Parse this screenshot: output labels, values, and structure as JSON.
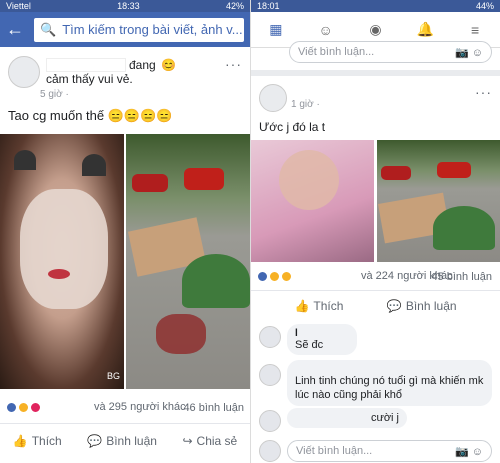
{
  "left": {
    "status": {
      "carrier": "Viettel",
      "time": "18:33",
      "battery": "42%"
    },
    "search": {
      "placeholder": "Tìm kiếm trong bài viết, ảnh v..."
    },
    "post": {
      "status_text": "đang",
      "feeling": "cảm thấy vui vẻ.",
      "meta": "5 giờ ·",
      "caption": "Tao cg muốn thế 😑😑😑😑",
      "photo_watermark": "BG",
      "reaction_count": "và 295 người khác",
      "comment_count": "46 bình luận",
      "actions": {
        "like": "Thích",
        "comment": "Bình luận",
        "share": "Chia sẻ"
      }
    }
  },
  "right": {
    "status": {
      "time": "18:01",
      "battery": "44%"
    },
    "prev_comment_placeholder": "Viết bình luận...",
    "post": {
      "meta": "1 giờ ·",
      "caption": "Ước j đó la t",
      "reaction_count": "và 224 người khác",
      "comment_count": "45 bình luận",
      "actions": {
        "like": "Thích",
        "comment": "Bình luận"
      }
    },
    "comments": [
      {
        "name": "l",
        "text": "Sẽ đc"
      },
      {
        "name": "",
        "text": "Linh tinh chúng nó tuổi gì mà khiến mk lúc nào cũng phải khổ"
      },
      {
        "name": "",
        "text": "cười j"
      }
    ],
    "write_comment_placeholder": "Viết bình luận..."
  },
  "colors": {
    "fb_blue": "#4267b2",
    "status_blue": "#3b5998"
  },
  "icons": [
    "back-arrow-icon",
    "search-icon",
    "home-icon",
    "friends-icon",
    "profile-icon",
    "bell-icon",
    "menu-icon",
    "like-icon",
    "comment-icon",
    "share-icon",
    "camera-icon",
    "sticker-icon"
  ]
}
